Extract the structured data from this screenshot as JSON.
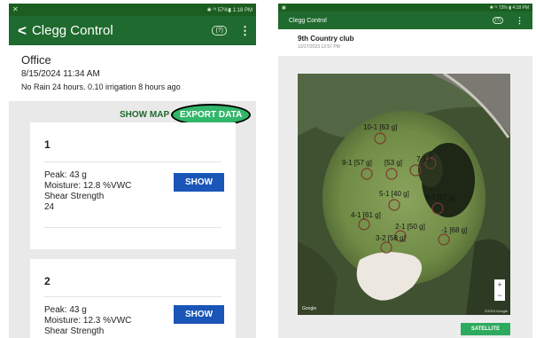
{
  "left": {
    "status_bar": {
      "left_icon": "✕",
      "right_text": "✱ ⁰ᵗ 57%▮ 1:18 PM"
    },
    "appbar": {
      "back_glyph": "<",
      "title": "Clegg Control",
      "help": "(?)",
      "menu": "⋮"
    },
    "location": {
      "name": "Office",
      "datetime": "8/15/2024 11:34 AM",
      "weather": "No Rain 24 hours. 0.10 irrigation 8 hours ago"
    },
    "actions": {
      "show_map": "SHOW MAP",
      "export_data": "EXPORT DATA"
    },
    "cards": [
      {
        "number": "1",
        "peak": "Peak: 43 g",
        "moisture": "Moisture: 12.8 %VWC",
        "shear_label": "Shear Strength",
        "shear_value": "24",
        "button": "SHOW"
      },
      {
        "number": "2",
        "peak": "Peak: 43 g",
        "moisture": "Moisture: 12.3 %VWC",
        "shear_label": "Shear Strength",
        "button": "SHOW"
      }
    ]
  },
  "right": {
    "status_bar": {
      "left_icon": "▣",
      "right_text": "✱ ⁰ᵗ 73% ▮ 4:18 PM"
    },
    "appbar": {
      "title": "Clegg Control",
      "help": "(?)",
      "menu": "⋮"
    },
    "club": {
      "name": "9th Country club",
      "datetime": "12/27/2023 12:57 PM"
    },
    "map": {
      "pins": [
        {
          "label": "10-1 [63 g]"
        },
        {
          "label": "9-1 [57 g]"
        },
        {
          "label": "[53 g]"
        },
        {
          "label": "7-1 ["
        },
        {
          "label": "6-"
        },
        {
          "label": "5-1 [40 g]"
        },
        {
          "label": "6-1 [57 g]"
        },
        {
          "label": "4-1 [61 g]"
        },
        {
          "label": "2-1 [50 g]"
        },
        {
          "label": "-1 [68 g]"
        },
        {
          "label": "3-2 [58 g]"
        }
      ],
      "zoom_in": "+",
      "zoom_out": "−",
      "google": "Google",
      "copyright": "©2023 Google"
    },
    "satellite_button": "SATELLITE"
  }
}
